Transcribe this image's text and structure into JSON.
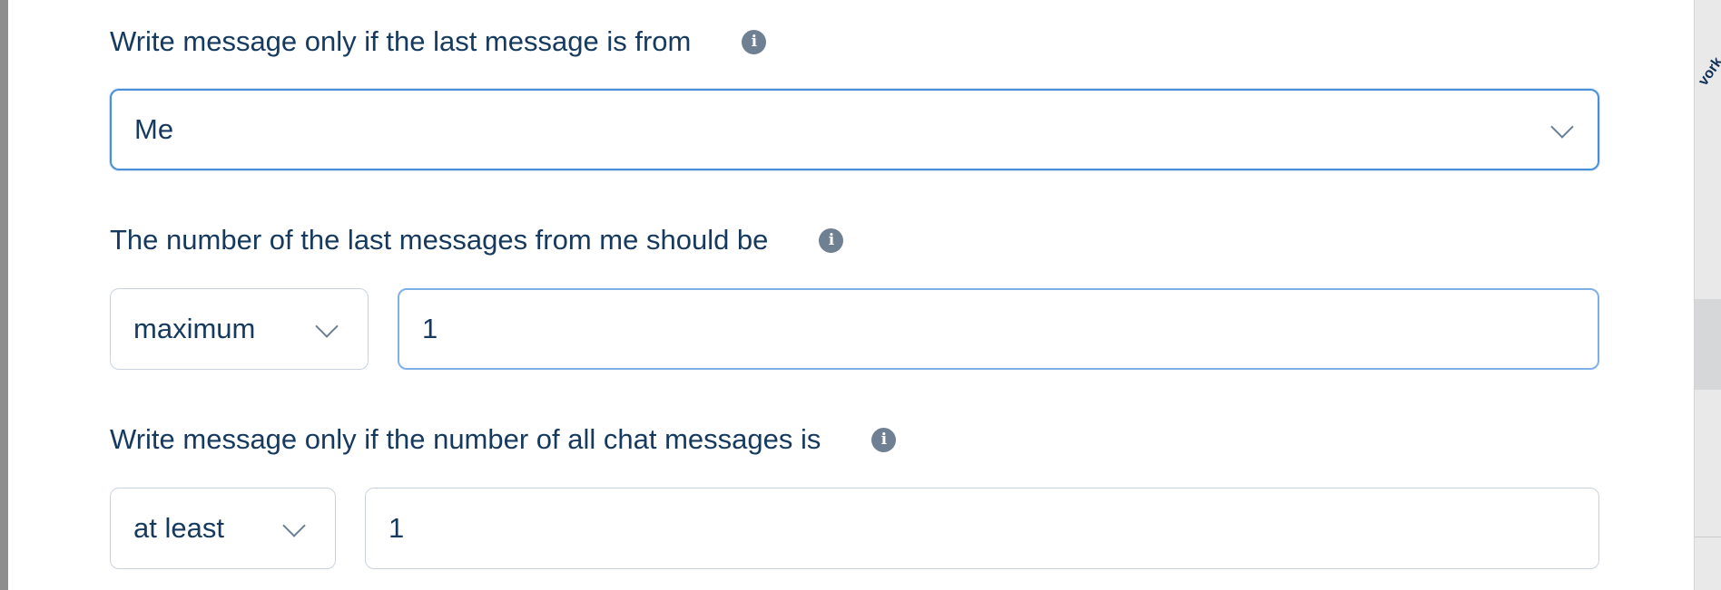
{
  "sidebar_peek": {
    "text": "vork"
  },
  "fields": {
    "last_message_from": {
      "label": "Write message only if the last message is from",
      "selected": "Me"
    },
    "last_messages_count": {
      "label": "The number of the last messages from me should be",
      "operator": "maximum",
      "value": "1"
    },
    "all_messages_count": {
      "label": "Write message only if the number of all chat messages is",
      "operator": "at least",
      "value": "1"
    }
  },
  "icons": {
    "info": "info-icon"
  },
  "colors": {
    "label_text": "#163a5f",
    "info_icon_bg": "#6f8093",
    "focus_border": "#4a90d9",
    "input_border": "#c9d3df"
  }
}
